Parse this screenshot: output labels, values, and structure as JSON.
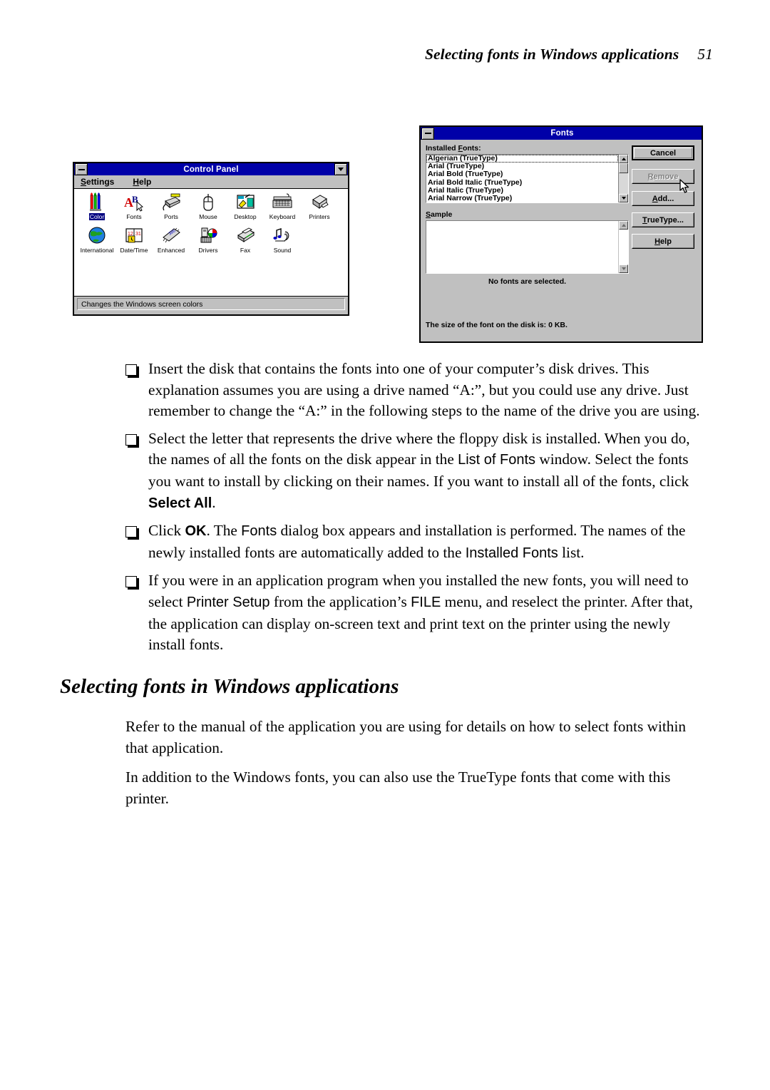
{
  "page": {
    "running_head": "Selecting fonts in Windows applications",
    "page_number": "51"
  },
  "control_panel": {
    "title": "Control Panel",
    "sysmenu_icon": "minimize-box-icon",
    "maximize_icon": "maximize-arrow-icon",
    "menu": [
      {
        "label": "Settings",
        "mnemonic": "S"
      },
      {
        "label": "Help",
        "mnemonic": "H"
      }
    ],
    "icons_row1": [
      {
        "label": "Color",
        "icon": "crayons-icon",
        "selected": true
      },
      {
        "label": "Fonts",
        "icon": "letters-ab-icon",
        "selected": false
      },
      {
        "label": "Ports",
        "icon": "serial-port-icon",
        "selected": false
      },
      {
        "label": "Mouse",
        "icon": "mouse-icon",
        "selected": false
      },
      {
        "label": "Desktop",
        "icon": "desktop-icon",
        "selected": false
      },
      {
        "label": "Keyboard",
        "icon": "keyboard-icon",
        "selected": false
      },
      {
        "label": "Printers",
        "icon": "printer-icon",
        "selected": false
      }
    ],
    "icons_row2": [
      {
        "label": "International",
        "icon": "globe-icon",
        "selected": false
      },
      {
        "label": "Date/Time",
        "icon": "calendar-icon",
        "selected": false
      },
      {
        "label": "Enhanced",
        "icon": "386-chip-icon",
        "selected": false
      },
      {
        "label": "Drivers",
        "icon": "drivers-icon",
        "selected": false
      },
      {
        "label": "Fax",
        "icon": "fax-icon",
        "selected": false
      },
      {
        "label": "Sound",
        "icon": "sound-icon",
        "selected": false
      }
    ],
    "status_text": "Changes the Windows screen colors"
  },
  "fonts_dialog": {
    "title": "Fonts",
    "sysmenu_icon": "minimize-box-icon",
    "installed_label": "Installed Fonts:",
    "installed_mnemonic": "F",
    "font_list": [
      "Algerian (TrueType)",
      "Arial (TrueType)",
      "Arial Bold (TrueType)",
      "Arial Bold Italic (TrueType)",
      "Arial Italic (TrueType)",
      "Arial Narrow (TrueType)"
    ],
    "sample_label": "Sample",
    "sample_mnemonic": "S",
    "sample_text": "",
    "no_fonts_text": "No fonts are selected.",
    "disk_size_text": "The size of the font on the disk is:  0 KB.",
    "buttons": [
      {
        "label": "Cancel",
        "mnemonic": "",
        "state": "default",
        "name": "cancel-button"
      },
      {
        "label": "Remove",
        "mnemonic": "R",
        "state": "disabled",
        "name": "remove-button"
      },
      {
        "label": "Add...",
        "mnemonic": "A",
        "state": "normal",
        "name": "add-button"
      },
      {
        "label": "TrueType...",
        "mnemonic": "T",
        "state": "normal",
        "name": "truetype-button"
      },
      {
        "label": "Help",
        "mnemonic": "H",
        "state": "normal",
        "name": "help-button"
      }
    ],
    "cursor": "mouse-pointer-icon"
  },
  "body": {
    "bullets": [
      {
        "id": "bullet-insert-disk",
        "runs": [
          {
            "t": "Insert the disk that contains the fonts into one of your computer’s disk drives. This explanation assumes you are using a drive named “A:”, but you could use any drive. Just remember to change the “A:” in the following steps to the name of the drive you are using.",
            "s": "serif"
          }
        ]
      },
      {
        "id": "bullet-select-letter",
        "runs": [
          {
            "t": "Select the letter that represents the drive where the floppy disk is installed. When you do, the names of all the fonts on the disk appear in the ",
            "s": "serif"
          },
          {
            "t": "List of Fonts",
            "s": "sans"
          },
          {
            "t": " window. Select the fonts you want to install by clicking on their names. If you want to install all of the fonts, click ",
            "s": "serif"
          },
          {
            "t": "Select All",
            "s": "sans-bold"
          },
          {
            "t": ".",
            "s": "serif"
          }
        ]
      },
      {
        "id": "bullet-click-ok",
        "runs": [
          {
            "t": "Click ",
            "s": "serif"
          },
          {
            "t": "OK",
            "s": "sans-bold"
          },
          {
            "t": ". The ",
            "s": "serif"
          },
          {
            "t": "Fonts",
            "s": "sans"
          },
          {
            "t": " dialog box appears and installation is performed. The names of the newly installed fonts are automatically added to the ",
            "s": "serif"
          },
          {
            "t": "Installed Fonts",
            "s": "sans"
          },
          {
            "t": " list.",
            "s": "serif"
          }
        ]
      },
      {
        "id": "bullet-printer-setup",
        "runs": [
          {
            "t": "If you were in an application program when you installed the new fonts, you will need to select ",
            "s": "serif"
          },
          {
            "t": "Printer Setup",
            "s": "sans"
          },
          {
            "t": " from the application’s ",
            "s": "serif"
          },
          {
            "t": "FILE",
            "s": "sans"
          },
          {
            "t": " menu, and reselect the printer. After that, the application can display on-screen text and print text on the printer using the newly install fonts.",
            "s": "serif"
          }
        ]
      }
    ],
    "section_heading": "Selecting fonts in Windows applications",
    "paragraph_1": "Refer to the manual of the application you are using for details on how to select fonts within that application.",
    "paragraph_2": "In addition to the Windows fonts, you can also use the TrueType fonts that come with this printer."
  },
  "colors": {
    "titlebar_blue": "#0000a8",
    "window_face": "#c0c0c0",
    "selection_blue": "#000080",
    "text_black": "#000000",
    "disabled_gray": "#808080"
  }
}
